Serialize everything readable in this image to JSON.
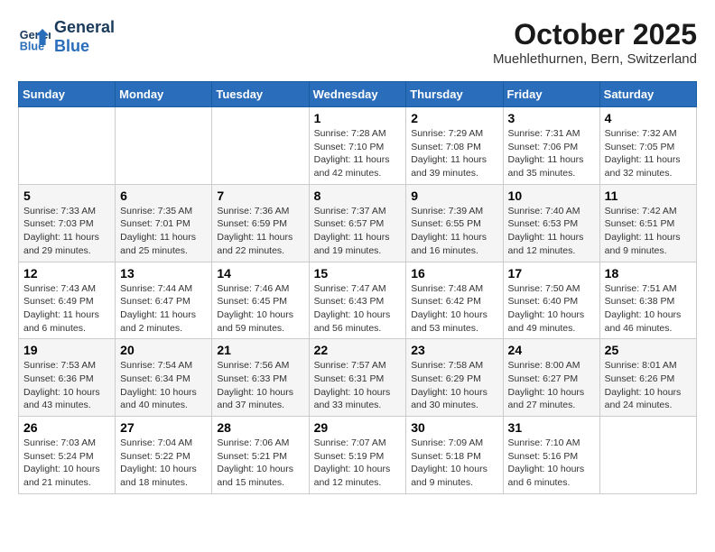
{
  "header": {
    "logo_general": "General",
    "logo_blue": "Blue",
    "month": "October 2025",
    "location": "Muehlethurnen, Bern, Switzerland"
  },
  "days_of_week": [
    "Sunday",
    "Monday",
    "Tuesday",
    "Wednesday",
    "Thursday",
    "Friday",
    "Saturday"
  ],
  "weeks": [
    [
      {
        "day": "",
        "info": ""
      },
      {
        "day": "",
        "info": ""
      },
      {
        "day": "",
        "info": ""
      },
      {
        "day": "1",
        "info": "Sunrise: 7:28 AM\nSunset: 7:10 PM\nDaylight: 11 hours\nand 42 minutes."
      },
      {
        "day": "2",
        "info": "Sunrise: 7:29 AM\nSunset: 7:08 PM\nDaylight: 11 hours\nand 39 minutes."
      },
      {
        "day": "3",
        "info": "Sunrise: 7:31 AM\nSunset: 7:06 PM\nDaylight: 11 hours\nand 35 minutes."
      },
      {
        "day": "4",
        "info": "Sunrise: 7:32 AM\nSunset: 7:05 PM\nDaylight: 11 hours\nand 32 minutes."
      }
    ],
    [
      {
        "day": "5",
        "info": "Sunrise: 7:33 AM\nSunset: 7:03 PM\nDaylight: 11 hours\nand 29 minutes."
      },
      {
        "day": "6",
        "info": "Sunrise: 7:35 AM\nSunset: 7:01 PM\nDaylight: 11 hours\nand 25 minutes."
      },
      {
        "day": "7",
        "info": "Sunrise: 7:36 AM\nSunset: 6:59 PM\nDaylight: 11 hours\nand 22 minutes."
      },
      {
        "day": "8",
        "info": "Sunrise: 7:37 AM\nSunset: 6:57 PM\nDaylight: 11 hours\nand 19 minutes."
      },
      {
        "day": "9",
        "info": "Sunrise: 7:39 AM\nSunset: 6:55 PM\nDaylight: 11 hours\nand 16 minutes."
      },
      {
        "day": "10",
        "info": "Sunrise: 7:40 AM\nSunset: 6:53 PM\nDaylight: 11 hours\nand 12 minutes."
      },
      {
        "day": "11",
        "info": "Sunrise: 7:42 AM\nSunset: 6:51 PM\nDaylight: 11 hours\nand 9 minutes."
      }
    ],
    [
      {
        "day": "12",
        "info": "Sunrise: 7:43 AM\nSunset: 6:49 PM\nDaylight: 11 hours\nand 6 minutes."
      },
      {
        "day": "13",
        "info": "Sunrise: 7:44 AM\nSunset: 6:47 PM\nDaylight: 11 hours\nand 2 minutes."
      },
      {
        "day": "14",
        "info": "Sunrise: 7:46 AM\nSunset: 6:45 PM\nDaylight: 10 hours\nand 59 minutes."
      },
      {
        "day": "15",
        "info": "Sunrise: 7:47 AM\nSunset: 6:43 PM\nDaylight: 10 hours\nand 56 minutes."
      },
      {
        "day": "16",
        "info": "Sunrise: 7:48 AM\nSunset: 6:42 PM\nDaylight: 10 hours\nand 53 minutes."
      },
      {
        "day": "17",
        "info": "Sunrise: 7:50 AM\nSunset: 6:40 PM\nDaylight: 10 hours\nand 49 minutes."
      },
      {
        "day": "18",
        "info": "Sunrise: 7:51 AM\nSunset: 6:38 PM\nDaylight: 10 hours\nand 46 minutes."
      }
    ],
    [
      {
        "day": "19",
        "info": "Sunrise: 7:53 AM\nSunset: 6:36 PM\nDaylight: 10 hours\nand 43 minutes."
      },
      {
        "day": "20",
        "info": "Sunrise: 7:54 AM\nSunset: 6:34 PM\nDaylight: 10 hours\nand 40 minutes."
      },
      {
        "day": "21",
        "info": "Sunrise: 7:56 AM\nSunset: 6:33 PM\nDaylight: 10 hours\nand 37 minutes."
      },
      {
        "day": "22",
        "info": "Sunrise: 7:57 AM\nSunset: 6:31 PM\nDaylight: 10 hours\nand 33 minutes."
      },
      {
        "day": "23",
        "info": "Sunrise: 7:58 AM\nSunset: 6:29 PM\nDaylight: 10 hours\nand 30 minutes."
      },
      {
        "day": "24",
        "info": "Sunrise: 8:00 AM\nSunset: 6:27 PM\nDaylight: 10 hours\nand 27 minutes."
      },
      {
        "day": "25",
        "info": "Sunrise: 8:01 AM\nSunset: 6:26 PM\nDaylight: 10 hours\nand 24 minutes."
      }
    ],
    [
      {
        "day": "26",
        "info": "Sunrise: 7:03 AM\nSunset: 5:24 PM\nDaylight: 10 hours\nand 21 minutes."
      },
      {
        "day": "27",
        "info": "Sunrise: 7:04 AM\nSunset: 5:22 PM\nDaylight: 10 hours\nand 18 minutes."
      },
      {
        "day": "28",
        "info": "Sunrise: 7:06 AM\nSunset: 5:21 PM\nDaylight: 10 hours\nand 15 minutes."
      },
      {
        "day": "29",
        "info": "Sunrise: 7:07 AM\nSunset: 5:19 PM\nDaylight: 10 hours\nand 12 minutes."
      },
      {
        "day": "30",
        "info": "Sunrise: 7:09 AM\nSunset: 5:18 PM\nDaylight: 10 hours\nand 9 minutes."
      },
      {
        "day": "31",
        "info": "Sunrise: 7:10 AM\nSunset: 5:16 PM\nDaylight: 10 hours\nand 6 minutes."
      },
      {
        "day": "",
        "info": ""
      }
    ]
  ]
}
